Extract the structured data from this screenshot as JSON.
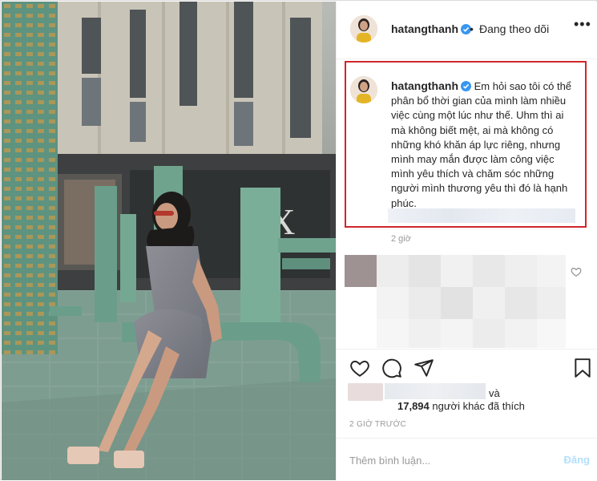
{
  "header": {
    "username": "hatangthanh",
    "separator": "•",
    "follow_status": "Đang theo dõi",
    "more_icon": "more-horizontal-icon"
  },
  "caption": {
    "username": "hatangthanh",
    "text": "Em hỏi sao tôi có thể phân bổ thời gian của mình làm nhiều việc cùng một lúc như thế. Uhm thì ai mà không biết mệt, ai mà không có những khó khăn áp lực riêng, nhưng mình may mắn được làm công việc mình yêu thích và chăm sóc những người mình thương yêu thì đó là hạnh phúc.",
    "time": "2 giờ",
    "highlight_color": "#d0262c"
  },
  "likes": {
    "and": "và",
    "count": "17,894",
    "others_text": " người khác đã thích"
  },
  "timestamp": "2 GIỜ TRƯỚC",
  "comment_box": {
    "placeholder": "Thêm bình luận...",
    "post_label": "Đăng"
  },
  "colors": {
    "verified": "#3897f0",
    "post_button": "#b2dffc",
    "border": "#dbdbdb"
  },
  "icons": [
    "heart-icon",
    "comment-icon",
    "share-icon",
    "bookmark-icon",
    "verified-badge-icon"
  ]
}
